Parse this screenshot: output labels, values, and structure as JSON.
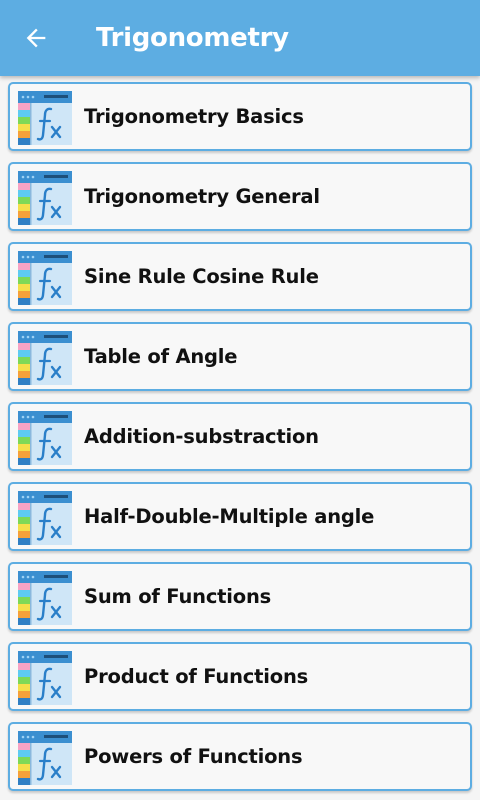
{
  "header": {
    "title": "Trigonometry",
    "back_icon": "arrow-left-icon",
    "background": "#5dade2"
  },
  "topics": [
    {
      "label": "Trigonometry Basics",
      "icon": "formula-fx-icon"
    },
    {
      "label": "Trigonometry General",
      "icon": "formula-fx-icon"
    },
    {
      "label": "Sine Rule Cosine Rule",
      "icon": "formula-fx-icon"
    },
    {
      "label": "Table of Angle",
      "icon": "formula-fx-icon"
    },
    {
      "label": "Addition-substraction",
      "icon": "formula-fx-icon"
    },
    {
      "label": "Half-Double-Multiple angle",
      "icon": "formula-fx-icon"
    },
    {
      "label": "Sum of Functions",
      "icon": "formula-fx-icon"
    },
    {
      "label": "Product of Functions",
      "icon": "formula-fx-icon"
    },
    {
      "label": "Powers of Functions",
      "icon": "formula-fx-icon"
    }
  ],
  "colors": {
    "accent": "#5dade2",
    "card_border": "#5dade2"
  }
}
